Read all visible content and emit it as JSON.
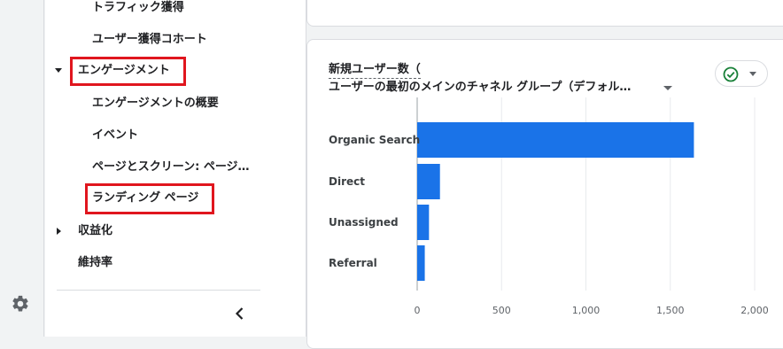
{
  "sidebar": {
    "items": [
      {
        "label": "トラフィック獲得"
      },
      {
        "label": "ユーザー獲得コホート"
      },
      {
        "label": "エンゲージメント"
      },
      {
        "label": "エンゲージメントの概要"
      },
      {
        "label": "イベント"
      },
      {
        "label": "ページとスクリーン: ページ…"
      },
      {
        "label": "ランディング ページ"
      },
      {
        "label": "収益化"
      },
      {
        "label": "維持率"
      }
    ],
    "collapse_icon": "chevron-left-icon",
    "settings_icon": "gear-icon"
  },
  "card": {
    "title_line1": "新規ユーザー数（",
    "title_line2": "ユーザーの最初のメインのチャネル グループ（デフォル…",
    "status_icon": "check-circle-icon"
  },
  "colors": {
    "bar": "#1a73e8",
    "highlight": "#e0161e",
    "status_ok": "#188038"
  },
  "chart_data": {
    "type": "bar",
    "orientation": "horizontal",
    "categories": [
      "Organic Search",
      "Direct",
      "Unassigned",
      "Referral"
    ],
    "values": [
      1640,
      135,
      70,
      45
    ],
    "xlim": [
      0,
      2000
    ],
    "xticks": [
      "0",
      "500",
      "1,000",
      "1,500",
      "2,000"
    ],
    "grid": true
  }
}
